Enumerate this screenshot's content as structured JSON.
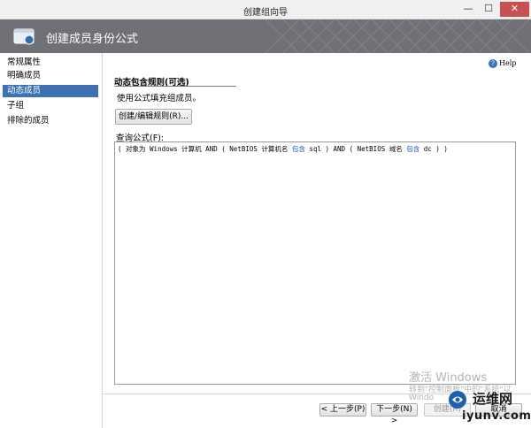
{
  "window": {
    "title": "创建组向导",
    "minimize": "—",
    "maximize": "☐",
    "close": "✕"
  },
  "banner": {
    "title": "创建成员身份公式"
  },
  "sidebar": {
    "items": [
      {
        "label": "常规属性"
      },
      {
        "label": "明确成员"
      },
      {
        "label": "动态成员"
      },
      {
        "label": "子组"
      },
      {
        "label": "排除的成员"
      }
    ],
    "active_index": 2
  },
  "help": {
    "label": "Help",
    "icon": "?"
  },
  "main": {
    "heading": "动态包含规则(可选)",
    "description": "使用公式填充组成员。",
    "edit_button": "创建/编辑规则(R)...",
    "query_label": "查询公式(F):",
    "query": {
      "p1": "( 对象为 Windows 计算机 AND ( NetBIOS 计算机名 ",
      "kw1": "包含",
      "p2": " sql ) AND ( NetBIOS 域名 ",
      "kw2": "包含",
      "p3": " dc ) )"
    }
  },
  "footer": {
    "prev": "< 上一步(P)",
    "next": "下一步(N) >",
    "create": "创建(R)",
    "cancel": "取消"
  },
  "overlay": {
    "activate_title": "激活 Windows",
    "activate_line1": "转到\"控制面板\"中的\"系统\"以",
    "activate_line2": "Windo",
    "watermark_name": "运维网",
    "watermark_domain": "iyunv.com"
  },
  "colors": {
    "banner": "#6f7176",
    "active": "#3d71b3",
    "keyword": "#1a4fd1",
    "close": "#c75050"
  }
}
